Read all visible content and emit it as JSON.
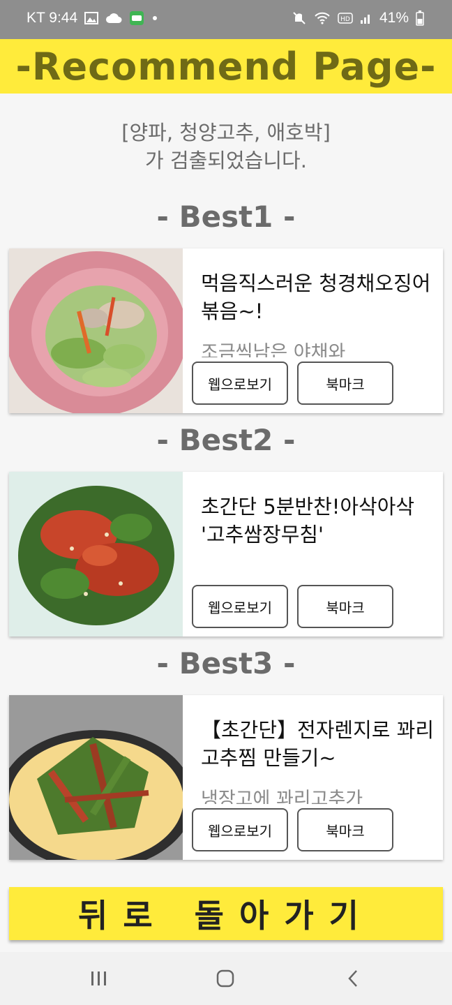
{
  "status_bar": {
    "carrier_time": "KT 9:44",
    "battery": "41%",
    "icons": [
      "gallery-icon",
      "cloud-icon",
      "app-badge-icon",
      "dot-icon",
      "mute-icon",
      "wifi-icon",
      "hd-icon",
      "signal-icon",
      "battery-icon"
    ]
  },
  "app_bar": {
    "title": "-Recommend Page-"
  },
  "detected": {
    "line1": "[양파, 청양고추, 애호박]",
    "line2": "가 검출되었습니다."
  },
  "recommendations": [
    {
      "heading": "- Best1 -",
      "title": "먹음직스러운 청경채오징어볶음~!",
      "description": "조금씩남은 야채와",
      "web_label": "웹으로보기",
      "bookmark_label": "북마크"
    },
    {
      "heading": "- Best2 -",
      "title": "초간단 5분반찬!아삭아삭 '고추쌈장무침'",
      "description": "",
      "web_label": "웹으로보기",
      "bookmark_label": "북마크"
    },
    {
      "heading": "- Best3 -",
      "title": "【초간단】전자렌지로 꽈리고추찜 만들기~",
      "description": "냉장고에 꽈리고추가",
      "web_label": "웹으로보기",
      "bookmark_label": "북마크"
    }
  ],
  "back_button": {
    "label": "뒤로 돌아가기"
  },
  "colors": {
    "accent_yellow": "#ffeb3b",
    "title_olive": "#6f6a16",
    "heading_gray": "#6b6b6b"
  },
  "nav_bar": {
    "icons": [
      "recent-apps-icon",
      "home-icon",
      "back-icon"
    ]
  }
}
